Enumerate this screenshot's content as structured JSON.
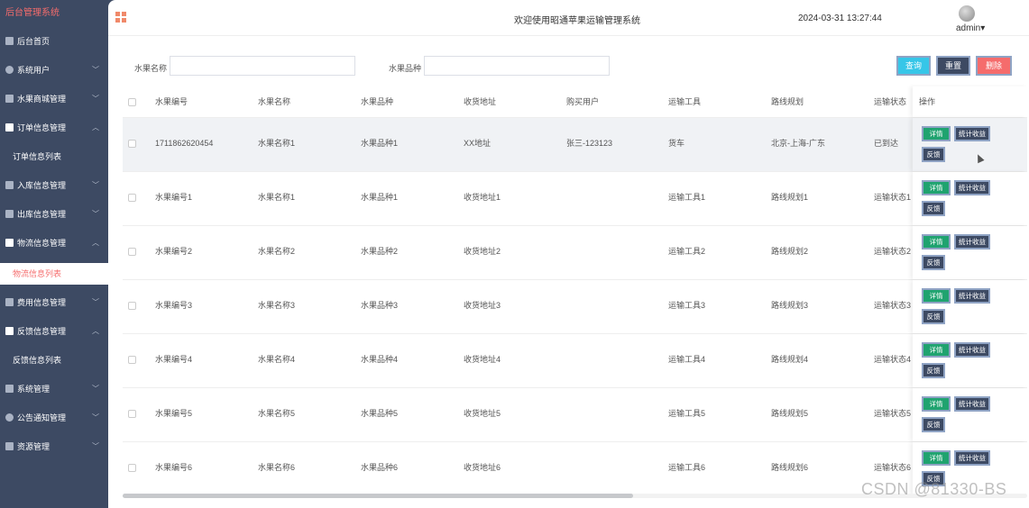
{
  "sidebar": {
    "brand": "后台管理系统",
    "items": [
      {
        "label": "后台首页",
        "has_chevron": false
      },
      {
        "label": "系统用户",
        "chevron": "﹀"
      },
      {
        "label": "水果商城管理",
        "chevron": "﹀"
      },
      {
        "label": "订单信息管理",
        "chevron": "︿"
      },
      {
        "label": "订单信息列表"
      },
      {
        "label": "入库信息管理",
        "chevron": "﹀"
      },
      {
        "label": "出库信息管理",
        "chevron": "﹀"
      },
      {
        "label": "物流信息管理",
        "chevron": "︿"
      },
      {
        "label": "物流信息列表"
      },
      {
        "label": "费用信息管理",
        "chevron": "﹀"
      },
      {
        "label": "反馈信息管理",
        "chevron": "︿"
      },
      {
        "label": "反馈信息列表"
      },
      {
        "label": "系统管理",
        "chevron": "﹀"
      },
      {
        "label": "公告通知管理",
        "chevron": "﹀"
      },
      {
        "label": "资源管理",
        "chevron": "﹀"
      }
    ]
  },
  "header": {
    "welcome": "欢迎使用昭通苹果运输管理系统",
    "datetime": "2024-03-31 13:27:44",
    "user": "admin",
    "user_caret": "▾"
  },
  "search": {
    "name_label": "水果名称",
    "name_value": "",
    "variety_label": "水果品种",
    "variety_value": "",
    "query_button": "查询",
    "reset_button": "重置",
    "delete_button": "删除"
  },
  "table": {
    "columns": [
      "水果编号",
      "水果名称",
      "水果品种",
      "收货地址",
      "购买用户",
      "运输工具",
      "路线规划",
      "运输状态"
    ],
    "ops_header": "操作",
    "ops": {
      "detail": "详情",
      "stats": "统计收益",
      "feedback": "反馈"
    },
    "rows": [
      [
        "1711862620454",
        "水果名称1",
        "水果品种1",
        "XX地址",
        "张三-123123",
        "货车",
        "北京-上海-广东",
        "已到达"
      ],
      [
        "水果编号1",
        "水果名称1",
        "水果品种1",
        "收货地址1",
        "",
        "运输工具1",
        "路线规划1",
        "运输状态1"
      ],
      [
        "水果编号2",
        "水果名称2",
        "水果品种2",
        "收货地址2",
        "",
        "运输工具2",
        "路线规划2",
        "运输状态2"
      ],
      [
        "水果编号3",
        "水果名称3",
        "水果品种3",
        "收货地址3",
        "",
        "运输工具3",
        "路线规划3",
        "运输状态3"
      ],
      [
        "水果编号4",
        "水果名称4",
        "水果品种4",
        "收货地址4",
        "",
        "运输工具4",
        "路线规划4",
        "运输状态4"
      ],
      [
        "水果编号5",
        "水果名称5",
        "水果品种5",
        "收货地址5",
        "",
        "运输工具5",
        "路线规划5",
        "运输状态5"
      ],
      [
        "水果编号6",
        "水果名称6",
        "水果品种6",
        "收货地址6",
        "",
        "运输工具6",
        "路线规划6",
        "运输状态6"
      ]
    ]
  },
  "watermark": "CSDN @81330-BS",
  "colors": {
    "sidebar": "#3d4a63",
    "brand": "#f56c6c",
    "query": "#36c6e8",
    "delete": "#f56c6c",
    "detail": "#1fa36f"
  }
}
